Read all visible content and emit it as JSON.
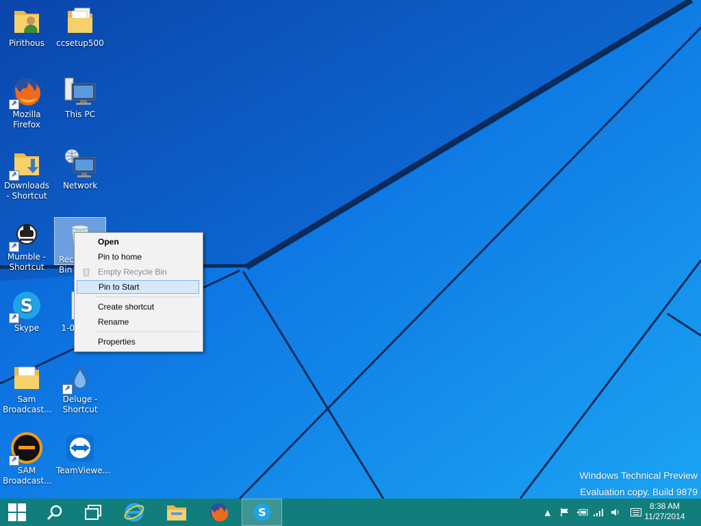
{
  "desktop_icons": [
    {
      "label": "Pirithous",
      "icon": "user-folder-icon"
    },
    {
      "label": "ccsetup500",
      "icon": "folder-icon"
    },
    {
      "label": "Mozilla Firefox",
      "icon": "firefox-icon"
    },
    {
      "label": "This PC",
      "icon": "computer-icon"
    },
    {
      "label": "Downloads - Shortcut",
      "icon": "downloads-folder-icon"
    },
    {
      "label": "Network",
      "icon": "network-icon"
    },
    {
      "label": "Mumble - Shortcut",
      "icon": "mumble-icon"
    },
    {
      "label": "Recycle Bin",
      "icon": "recycle-bin-icon"
    },
    {
      "label": "Skype",
      "icon": "skype-icon"
    },
    {
      "label": "1-01 Carl",
      "icon": "file-icon"
    },
    {
      "label": "Sam Broadcast...",
      "icon": "folder-icon"
    },
    {
      "label": "Deluge - Shortcut",
      "icon": "deluge-icon"
    },
    {
      "label": "SAM Broadcast...",
      "icon": "sam-broadcaster-icon"
    },
    {
      "label": "TeamViewe...",
      "icon": "teamviewer-icon"
    }
  ],
  "context_menu": {
    "items": [
      {
        "label": "Open",
        "bold": true,
        "disabled": false
      },
      {
        "label": "Pin to home",
        "bold": false,
        "disabled": false
      },
      {
        "label": "Empty Recycle Bin",
        "bold": false,
        "disabled": true
      },
      {
        "label": "Pin to Start",
        "bold": false,
        "disabled": false,
        "highlighted": true
      },
      {
        "label": "Create shortcut",
        "bold": false,
        "disabled": false
      },
      {
        "label": "Rename",
        "bold": false,
        "disabled": false
      },
      {
        "label": "Properties",
        "bold": false,
        "disabled": false
      }
    ]
  },
  "watermark": {
    "line1": "Windows Technical Preview",
    "line2": "Evaluation copy. Build 9879"
  },
  "taskbar": {
    "buttons": [
      "start-icon",
      "search-icon",
      "task-view-icon",
      "internet-explorer-icon",
      "file-explorer-icon",
      "firefox-icon",
      "skype-icon"
    ],
    "active": "skype-icon",
    "tray_icons": [
      "show-hidden-icons-icon",
      "action-center-flag-icon",
      "power-icon",
      "network-signal-icon",
      "volume-icon",
      "keyboard-icon"
    ],
    "clock_time": "8:38 AM",
    "clock_date": "11/27/2014"
  },
  "colors": {
    "taskbar": "#127e7c",
    "wallpaper": "#1a8ff0",
    "menu_highlight": "#d7e8fa"
  }
}
